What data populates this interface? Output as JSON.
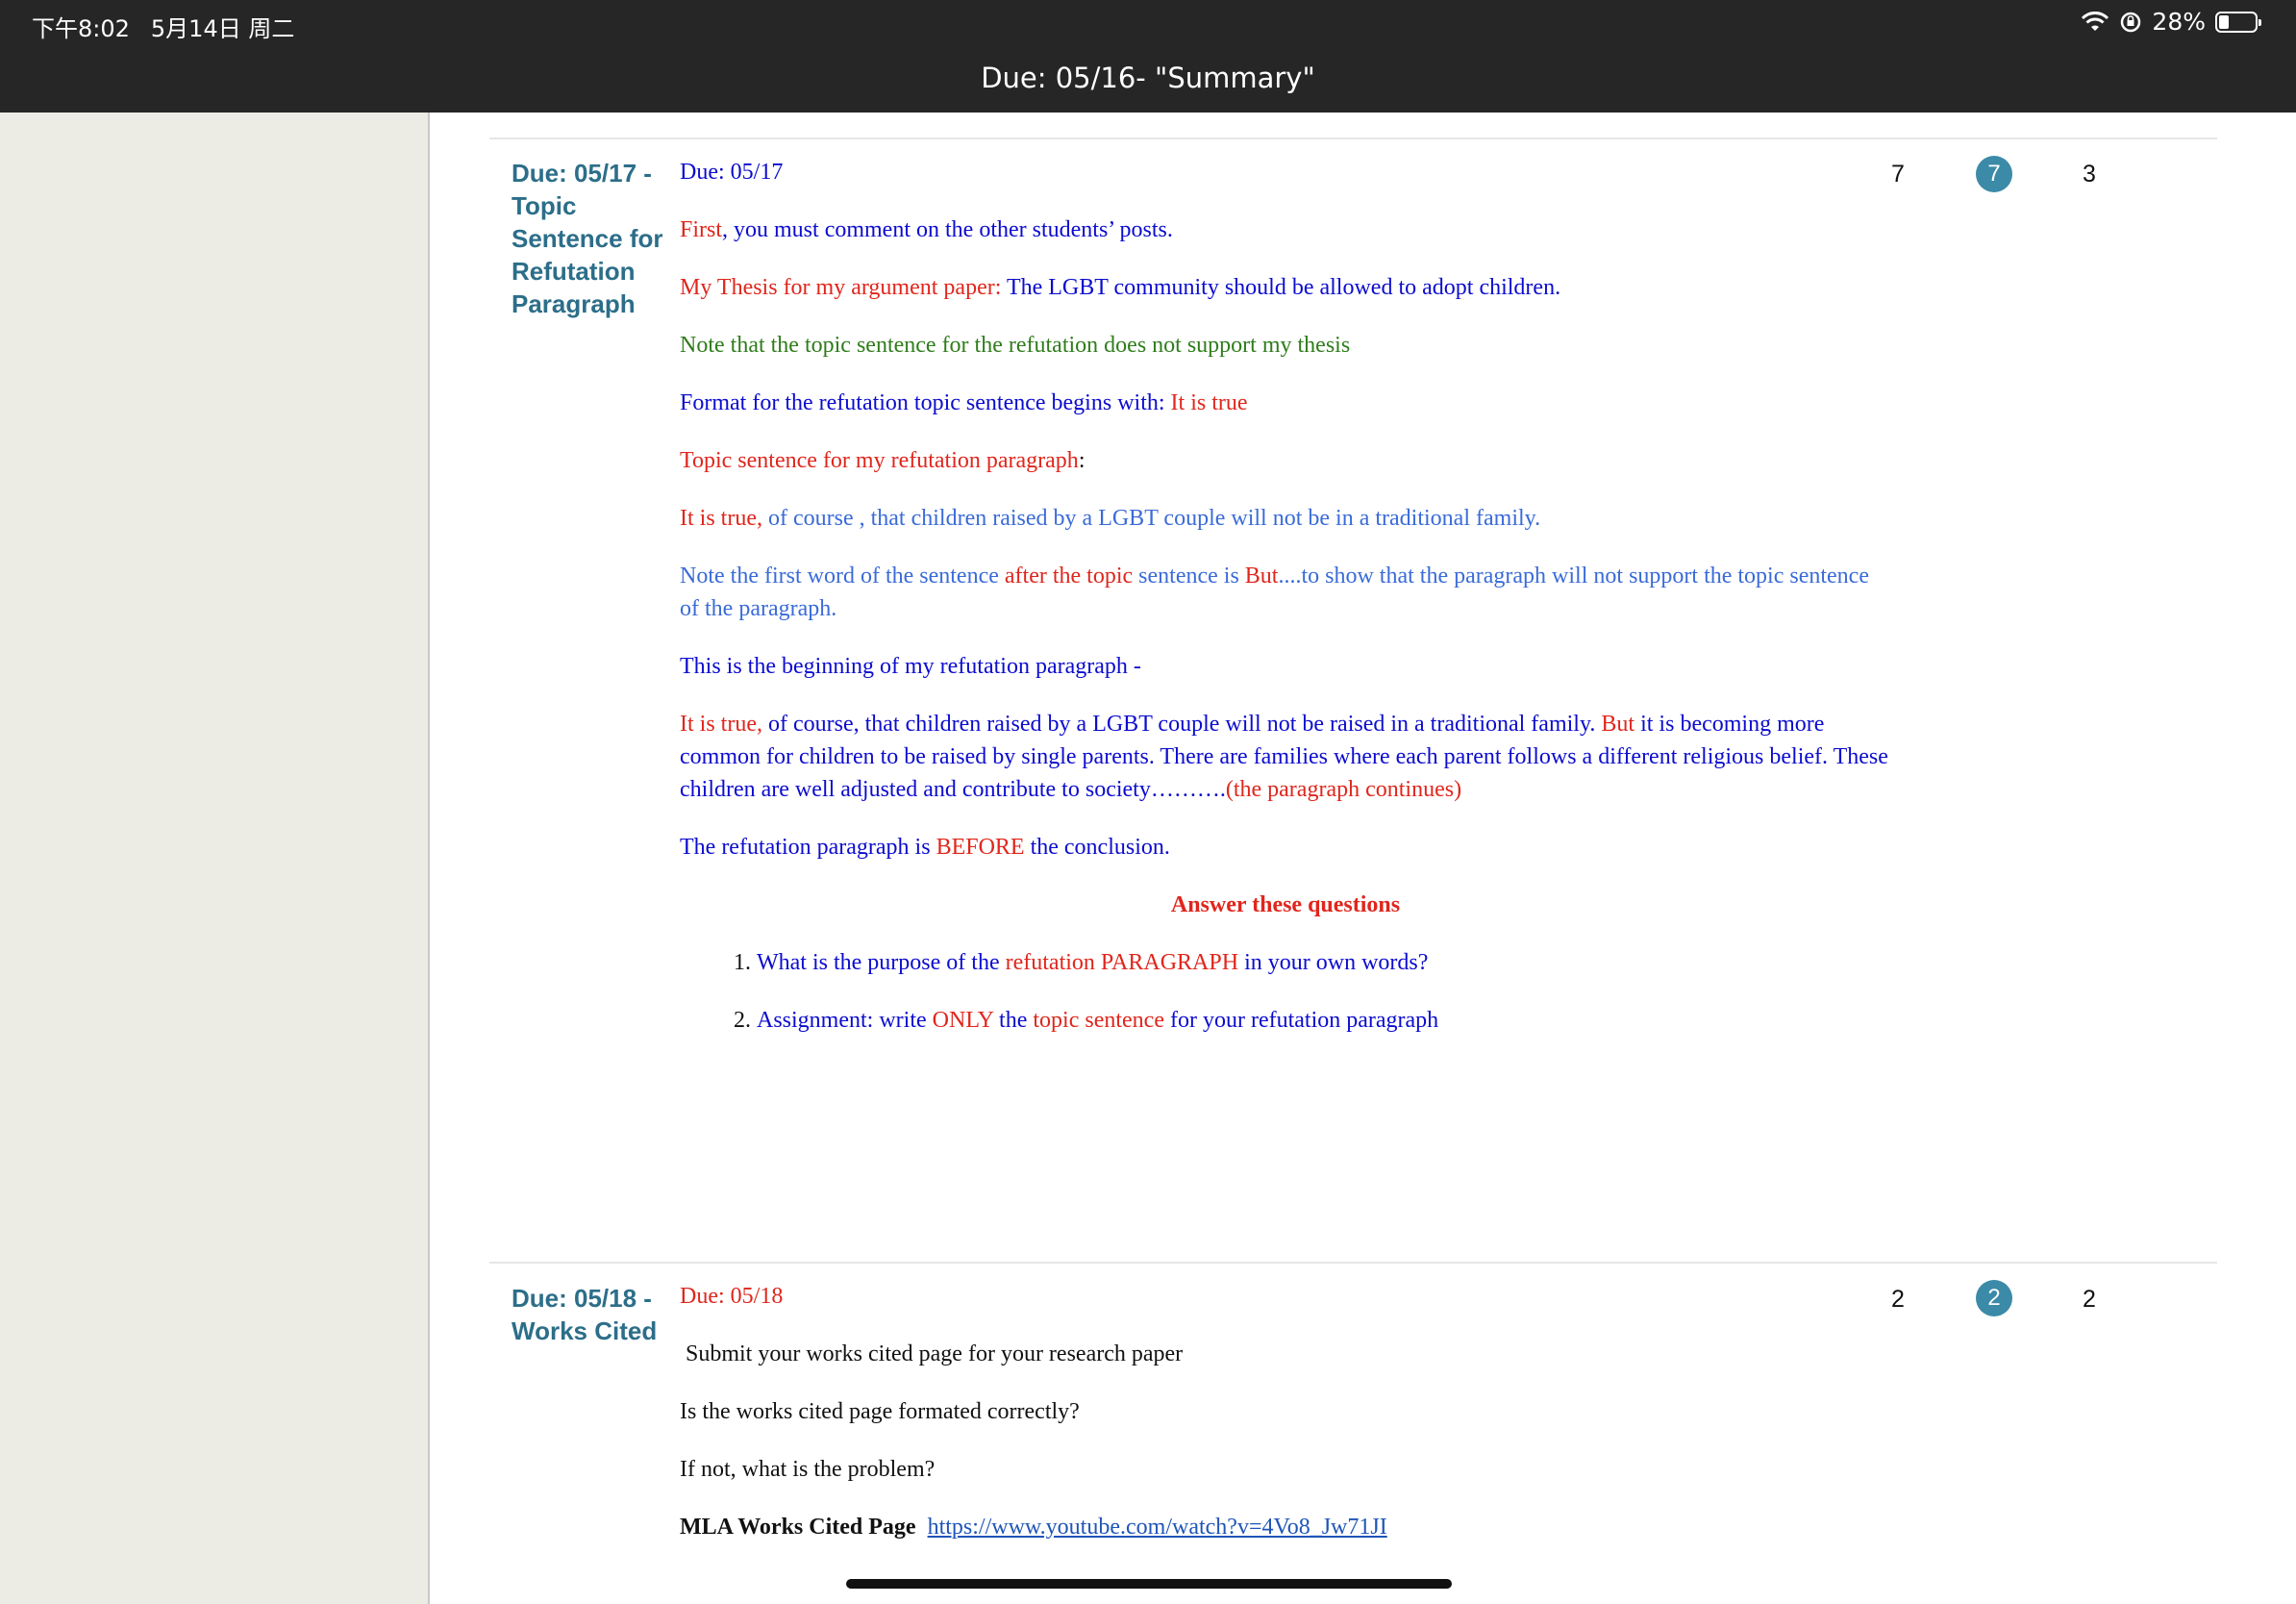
{
  "status_bar": {
    "time": "下午8:02",
    "date": "5月14日 周二",
    "battery": "28%",
    "battery_level": 0.28,
    "icons": [
      "wifi-icon",
      "rotation-lock-icon",
      "battery-icon"
    ]
  },
  "window": {
    "title": "Due: 05/16- \"Summary\""
  },
  "rows": [
    {
      "title": "Due: 05/17 - Topic Sentence for Refutation Paragraph",
      "counts": {
        "a": "7",
        "badge": "7",
        "b": "3"
      },
      "due": "Due: 05/17",
      "p1": {
        "a": "First",
        "b": ", you must comment on the other students’ posts."
      },
      "p2": {
        "a": "My Thesis for my argument paper:",
        "b": " The LGBT community should be allowed to adopt children."
      },
      "p3": "Note that the topic sentence for the refutation does not support my thesis",
      "p4": {
        "a": "Format for the refutation topic sentence begins with: ",
        "b": "It is true"
      },
      "p5": {
        "a": "Topic sentence for my refutation paragraph",
        "b": ":"
      },
      "p6": {
        "a": "It is true,",
        "b": " of course , that children raised by a LGBT couple will not be in a traditional family."
      },
      "p7": {
        "a": "Note the first word of the sentence ",
        "b": "after the topic",
        "c": " sentence is ",
        "d": "But",
        "e": "....to show that the paragraph will not support the topic sentence of the paragraph."
      },
      "p8": "This is the beginning of my refutation paragraph -",
      "p9": {
        "a": "It is true,",
        "b": " of course, that children raised by a LGBT couple will not be raised in a traditional family.  ",
        "c": "But",
        "d": " it is becoming more common for children to be raised by single parents. There are families where each parent follows a different religious belief. These children are well adjusted and contribute to society……….",
        "e": "(the paragraph continues)"
      },
      "p10": {
        "a": "The refutation paragraph is ",
        "b": "BEFORE",
        "c": " the conclusion."
      },
      "questions_heading": "Answer these questions",
      "q1": {
        "a": "What is the purpose of the ",
        "b": "refutation PARAGRAPH",
        "c": " in your own words?"
      },
      "q2": {
        "a": "Assignment: write ",
        "b": "ONLY",
        "c": " the ",
        "d": "topic sentence",
        "e": " for your refutation paragraph"
      }
    },
    {
      "title": "Due: 05/18 - Works Cited",
      "counts": {
        "a": "2",
        "badge": "2",
        "b": "2"
      },
      "due": "Due: 05/18",
      "p1": "Submit your works cited page for your research paper",
      "p2": "Is the works cited page formated correctly?",
      "p3": "If not, what is the problem?",
      "p4_label": "MLA Works Cited Page",
      "p4_link": "https://www.youtube.com/watch?v=4Vo8_Jw71JI"
    }
  ]
}
